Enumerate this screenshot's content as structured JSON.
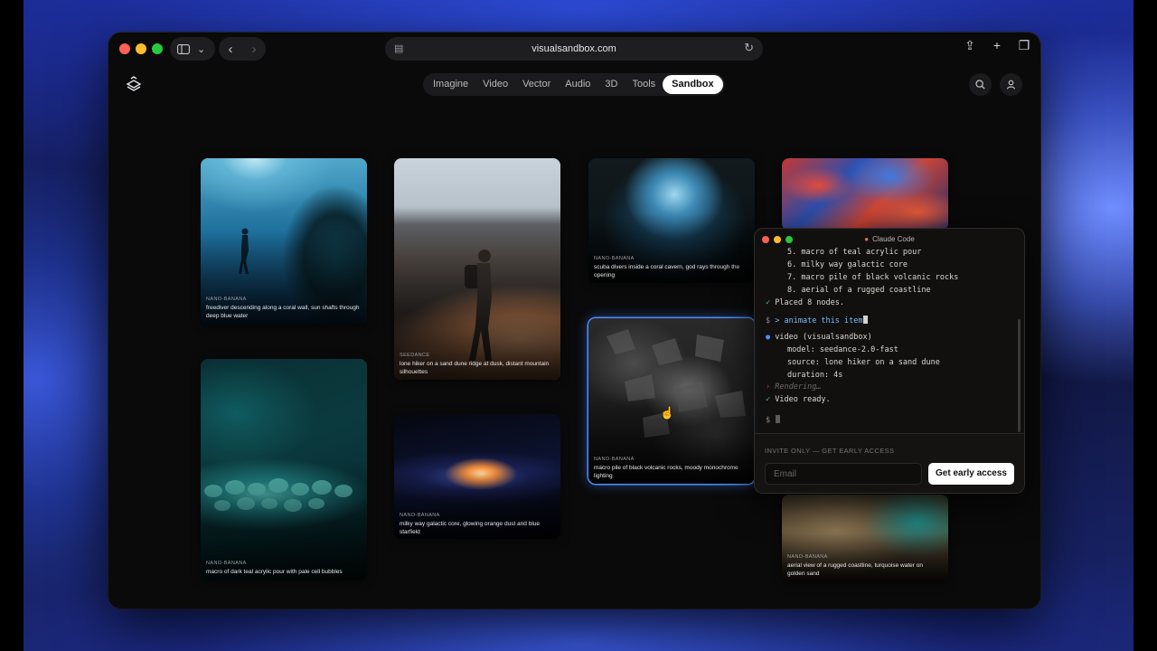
{
  "browser": {
    "url": "visualsandbox.com"
  },
  "nav": {
    "items": [
      "Imagine",
      "Video",
      "Vector",
      "Audio",
      "3D",
      "Tools",
      "Sandbox"
    ],
    "active": "Sandbox"
  },
  "cards": [
    {
      "model": "NANO-BANANA",
      "caption": "freediver descending along a coral wall, sun shafts through deep blue water"
    },
    {
      "model": "NANO-BANANA",
      "caption": "macro of dark teal acrylic pour with pale cell bubbles"
    },
    {
      "model": "SEEDANCE",
      "caption": "lone hiker on a sand dune ridge at dusk, distant mountain silhouettes"
    },
    {
      "model": "NANO-BANANA",
      "caption": "milky way galactic core, glowing orange dust and blue starfield"
    },
    {
      "model": "NANO-BANANA",
      "caption": "scuba divers inside a coral cavern, god rays through the opening"
    },
    {
      "model": "NANO-BANANA",
      "caption": "macro pile of black volcanic rocks, moody monochrome lighting"
    },
    {
      "model": "NANO-BANANA",
      "caption": "aerial view of a rugged coastline, turquoise water on golden sand"
    }
  ],
  "terminal": {
    "title": "Claude Code",
    "list": [
      "5. macro of teal acrylic pour",
      "6. milky way galactic core",
      "7. macro pile of black volcanic rocks",
      "8. aerial of a rugged coastline"
    ],
    "placed": "Placed 8 nodes.",
    "prompt_symbol": "$",
    "command": "> animate this item",
    "tool_call": "video (visualsandbox)",
    "params": [
      "model: seedance-2.0-fast",
      "source: lone hiker on a sand dune",
      "duration: 4s"
    ],
    "rendering": "Rendering…",
    "ready": "Video ready.",
    "invite": "INVITE ONLY — GET EARLY ACCESS",
    "email_placeholder": "Email",
    "cta": "Get early access"
  },
  "colors": {
    "accent_selected": "#4d8dff",
    "success": "#4ec98a",
    "claude_mark": "#d97757"
  }
}
